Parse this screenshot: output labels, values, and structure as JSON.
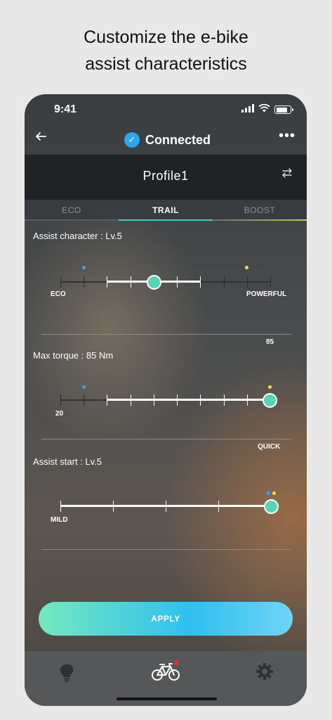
{
  "headline": {
    "line1": "Customize the e-bike",
    "line2": "assist characteristics"
  },
  "status_bar": {
    "time": "9:41"
  },
  "nav": {
    "back_icon": "arrow-left-icon",
    "connection_label": "Connected",
    "more_icon": "more-dots-icon"
  },
  "profile": {
    "name": "Profile1",
    "swap_icon": "swap-arrows-icon"
  },
  "tabs": [
    {
      "label": "ECO",
      "active": false,
      "color": "#8d9195"
    },
    {
      "label": "TRAIL",
      "active": true,
      "color": "#3fcfc0"
    },
    {
      "label": "BOOST",
      "active": false,
      "color": "#c8c860"
    }
  ],
  "settings": {
    "assist_character": {
      "title": "Assist character : Lv.5",
      "min_label": "ECO",
      "max_label": "POWERFUL",
      "range_label": "85",
      "level": 5,
      "levels": 10
    },
    "max_torque": {
      "title": "Max torque : 85 Nm",
      "min_label": "20",
      "max_label": "QUICK"
    },
    "assist_start": {
      "title": "Assist start : Lv.5",
      "min_label": "MILD"
    }
  },
  "apply_button": {
    "label": "APPLY"
  },
  "bottom_nav": [
    {
      "icon": "lightbulb-icon",
      "active": false
    },
    {
      "icon": "bicycle-icon",
      "active": true,
      "badge": true
    },
    {
      "icon": "gear-icon",
      "active": false
    }
  ],
  "colors": {
    "accent_teal": "#54d6b6",
    "accent_blue": "#2ea6f0",
    "marker_blue": "#2ea6f0",
    "marker_yellow": "#f4e23a",
    "badge_red": "#e0302a"
  }
}
